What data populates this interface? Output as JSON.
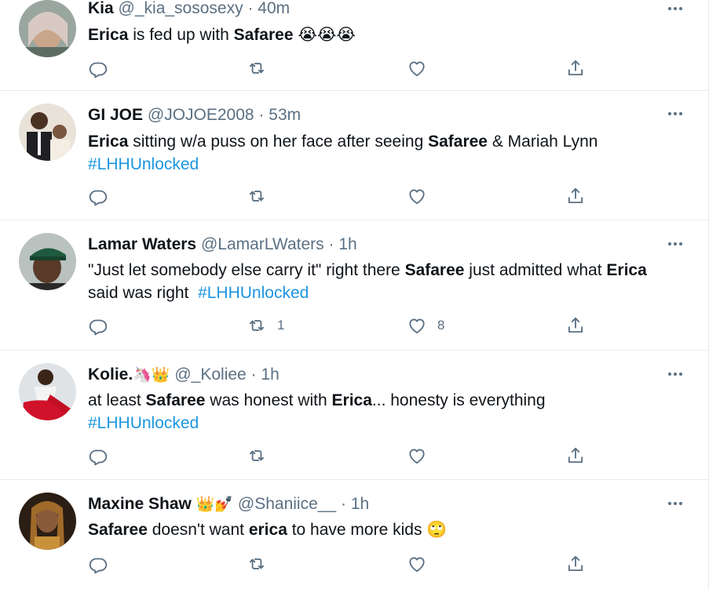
{
  "tweets": [
    {
      "name": "Kia",
      "badges": "",
      "handle": "@_kia_sososexy",
      "time": "40m",
      "line1": [
        {
          "b": "Erica"
        },
        {
          "t": " is fed up with "
        },
        {
          "b": "Safaree"
        },
        {
          "t": " 😭😭😭"
        }
      ],
      "line2": [],
      "retweets": "",
      "likes": ""
    },
    {
      "name": "GI JOE",
      "badges": "",
      "handle": "@JOJOE2008",
      "time": "53m",
      "line1": [
        {
          "b": "Erica"
        },
        {
          "t": " sitting w/a puss on her face after seeing "
        },
        {
          "b": "Safaree"
        },
        {
          "t": " & Mariah Lynn"
        }
      ],
      "line2": [
        {
          "h": "#LHHUnlocked"
        }
      ],
      "retweets": "",
      "likes": ""
    },
    {
      "name": "Lamar Waters",
      "badges": "",
      "handle": "@LamarLWaters",
      "time": "1h",
      "line1": [
        {
          "t": "\"Just let somebody else carry it\" right there "
        },
        {
          "b": "Safaree"
        },
        {
          "t": " just admitted what "
        },
        {
          "b": "Erica"
        }
      ],
      "line2": [
        {
          "t": "said was right  "
        },
        {
          "h": "#LHHUnlocked"
        }
      ],
      "retweets": "1",
      "likes": "8"
    },
    {
      "name": "Kolie.",
      "badges": "🦄👑",
      "handle": "@_Koliee",
      "time": "1h",
      "line1": [
        {
          "t": "at least "
        },
        {
          "b": "Safaree"
        },
        {
          "t": " was honest with "
        },
        {
          "b": "Erica"
        },
        {
          "t": "... honesty is everything"
        }
      ],
      "line2": [
        {
          "h": "#LHHUnlocked"
        }
      ],
      "retweets": "",
      "likes": ""
    },
    {
      "name": "Maxine Shaw",
      "badges": "👑💅",
      "handle": "@Shaniice__",
      "time": "1h",
      "line1": [
        {
          "b": "Safaree"
        },
        {
          "t": " doesn't want "
        },
        {
          "b": "erica"
        },
        {
          "t": " to have more kids 🙄"
        }
      ],
      "line2": [],
      "retweets": "",
      "likes": ""
    }
  ],
  "icons": {
    "reply": "reply-icon",
    "retweet": "retweet-icon",
    "like": "like-icon",
    "share": "share-icon",
    "more": "more-options-icon"
  },
  "colors": {
    "text": "#0f1419",
    "muted": "#5b7083",
    "hashtag": "#1b95e0",
    "divider": "#e6ecf0"
  }
}
